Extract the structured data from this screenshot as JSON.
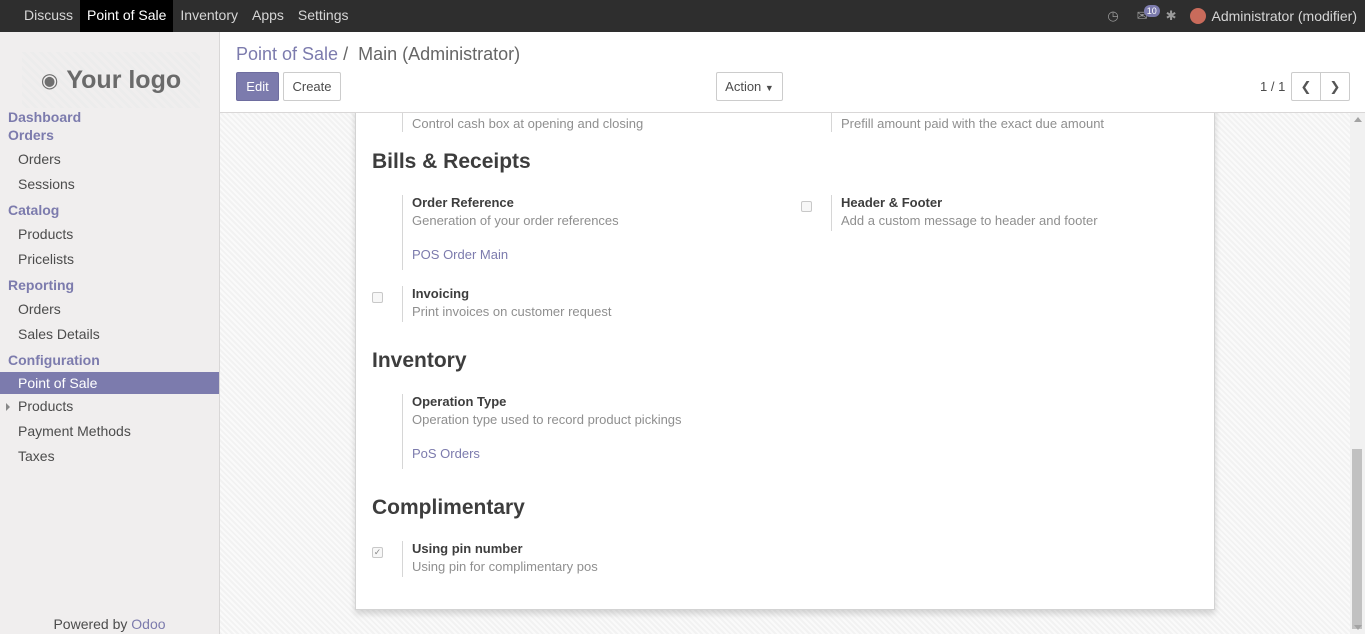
{
  "topbar": {
    "menu": [
      "Discuss",
      "Point of Sale",
      "Inventory",
      "Apps",
      "Settings"
    ],
    "active_index": 1,
    "messages_count": "10",
    "user": "Administrator (modifier)"
  },
  "sidebar": {
    "logo_text": "Your logo",
    "powered_by": "Powered by",
    "powered_brand": "Odoo",
    "items": [
      {
        "type": "head",
        "label": "Dashboard"
      },
      {
        "type": "head",
        "label": "Orders"
      },
      {
        "type": "item",
        "label": "Orders"
      },
      {
        "type": "item",
        "label": "Sessions"
      },
      {
        "type": "head",
        "label": "Catalog"
      },
      {
        "type": "item",
        "label": "Products"
      },
      {
        "type": "item",
        "label": "Pricelists"
      },
      {
        "type": "head",
        "label": "Reporting"
      },
      {
        "type": "item",
        "label": "Orders"
      },
      {
        "type": "item",
        "label": "Sales Details"
      },
      {
        "type": "head",
        "label": "Configuration"
      },
      {
        "type": "item",
        "label": "Point of Sale",
        "active": true
      },
      {
        "type": "item",
        "label": "Products",
        "caret": true
      },
      {
        "type": "item",
        "label": "Payment Methods"
      },
      {
        "type": "item",
        "label": "Taxes"
      }
    ]
  },
  "control": {
    "breadcrumb_parent": "Point of Sale",
    "breadcrumb_sep": "/",
    "breadcrumb_current": "Main (Administrator)",
    "edit_label": "Edit",
    "create_label": "Create",
    "action_label": "Action",
    "pager": "1 / 1"
  },
  "form": {
    "cut_left": "Control cash box at opening and closing",
    "cut_right": "Prefill amount paid with the exact due amount",
    "bills_title": "Bills & Receipts",
    "order_ref_label": "Order Reference",
    "order_ref_desc": "Generation of your order references",
    "order_ref_value": "POS Order Main",
    "header_footer_label": "Header & Footer",
    "header_footer_desc": "Add a custom message to header and footer",
    "invoicing_label": "Invoicing",
    "invoicing_desc": "Print invoices on customer request",
    "inventory_title": "Inventory",
    "op_type_label": "Operation Type",
    "op_type_desc": "Operation type used to record product pickings",
    "op_type_value": "PoS Orders",
    "complimentary_title": "Complimentary",
    "pin_label": "Using pin number",
    "pin_desc": "Using pin for complimentary pos"
  },
  "colors": {
    "accent": "#7c7bad",
    "topbar": "#2e2e2e",
    "sidebar": "#f0eeee"
  }
}
